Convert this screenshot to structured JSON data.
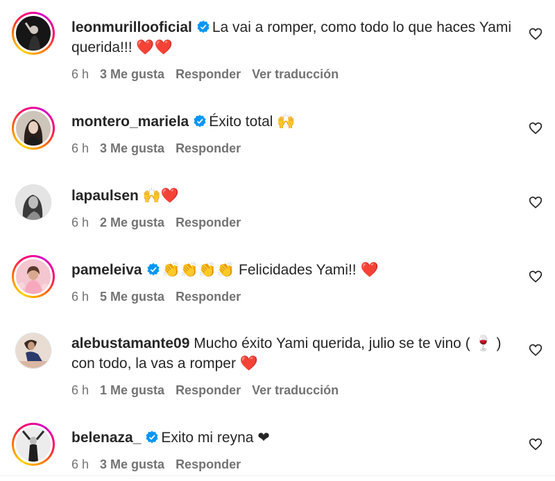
{
  "comments": [
    {
      "username": "leonmurillooficial",
      "verified": true,
      "text": "La vai a romper, como todo lo que haces Yami querida!!! ❤️❤️",
      "time": "6 h",
      "likes": "3 Me gusta",
      "reply": "Responder",
      "translate": "Ver traducción"
    },
    {
      "username": "montero_mariela",
      "verified": true,
      "text": "Éxito total 🙌",
      "time": "6 h",
      "likes": "3 Me gusta",
      "reply": "Responder"
    },
    {
      "username": "lapaulsen",
      "verified": false,
      "text": "🙌❤️",
      "time": "6 h",
      "likes": "2 Me gusta",
      "reply": "Responder"
    },
    {
      "username": "pameleiva",
      "verified": true,
      "text": "👏👏👏👏 Felicidades Yami!! ❤️",
      "time": "6 h",
      "likes": "5 Me gusta",
      "reply": "Responder"
    },
    {
      "username": "alebustamante09",
      "verified": false,
      "text": "Mucho éxito Yami querida, julio se te vino ( 🍷 ) con todo, la vas a romper ❤️",
      "time": "6 h",
      "likes": "1 Me gusta",
      "reply": "Responder",
      "translate": "Ver traducción"
    },
    {
      "username": "belenaza_",
      "verified": true,
      "text": "Exito mi reyna ❤",
      "time": "6 h",
      "likes": "3 Me gusta",
      "reply": "Responder"
    }
  ],
  "colors": {
    "verified": "#0095f6",
    "meta": "#737373",
    "text": "#262626"
  },
  "icons": {
    "like": "heart-outline-icon",
    "verified": "verified-badge-icon"
  }
}
